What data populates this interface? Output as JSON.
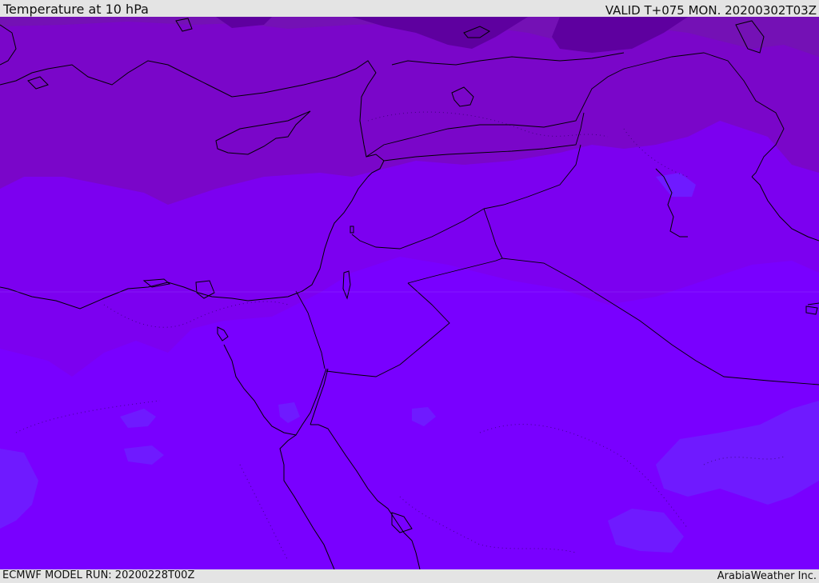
{
  "header": {
    "title": "Temperature at 10 hPa",
    "valid_time": "VALID T+075 MON. 20200302T03Z"
  },
  "footer": {
    "model_run": "ECMWF MODEL RUN: 20200228T00Z",
    "credit": "ArabiaWeather Inc."
  },
  "map": {
    "region": "Eastern Mediterranean, Levant and Red Sea",
    "field": "temperature",
    "colors": {
      "coldest_band": "#5e009f",
      "cold_band": "#7411b5",
      "cool_band": "#7a06c9",
      "mild_band": "#7c00f0",
      "base_band": "#7900ff",
      "warm_patch": "#6f1aff",
      "coastline": "#000000",
      "border": "#000000"
    }
  }
}
